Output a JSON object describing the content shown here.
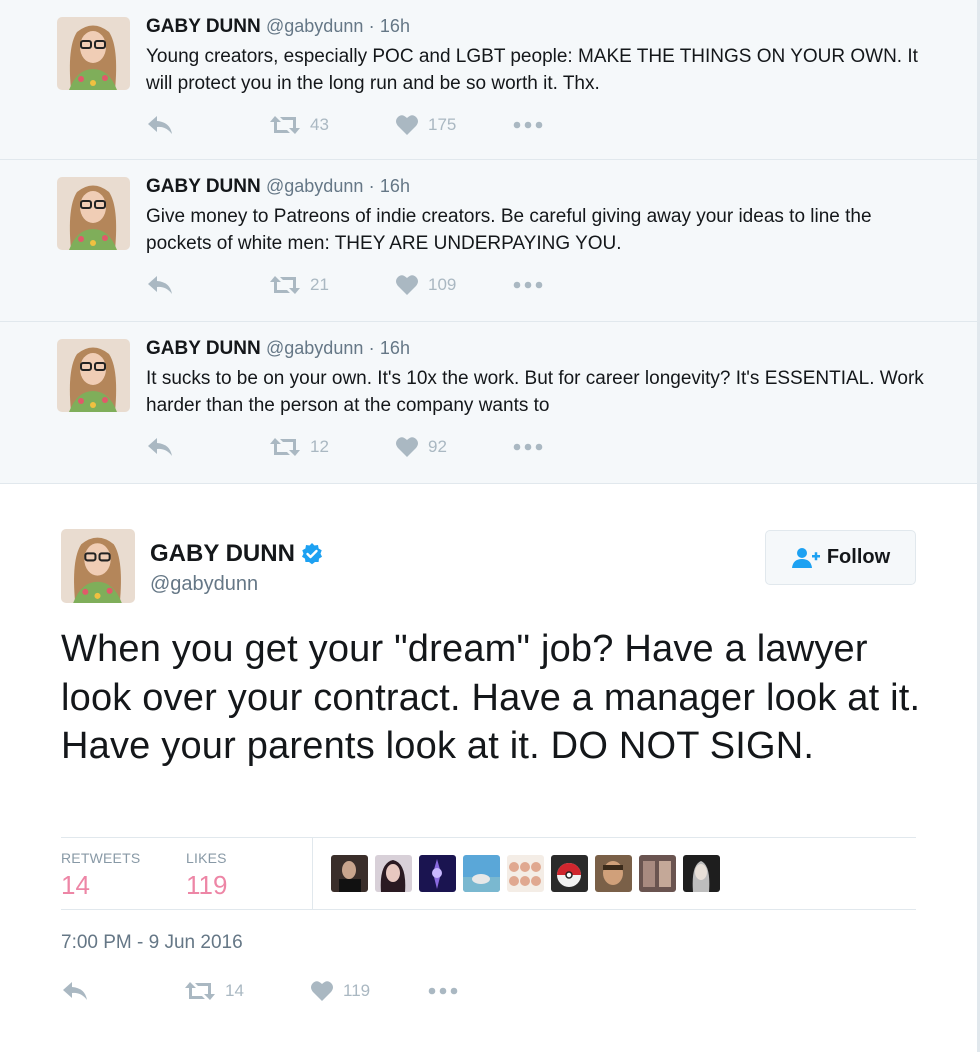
{
  "conversation": [
    {
      "name": "GABY DUNN",
      "handle": "@gabydunn",
      "time": "16h",
      "text": "Young creators, especially POC and LGBT people: MAKE THE THINGS ON YOUR OWN. It will protect you in the long run and be so worth it. Thx.",
      "retweets": "43",
      "likes": "175"
    },
    {
      "name": "GABY DUNN",
      "handle": "@gabydunn",
      "time": "16h",
      "text": "Give money to Patreons of indie creators. Be careful giving away your ideas to line the pockets of white men: THEY ARE UNDERPAYING YOU.",
      "retweets": "21",
      "likes": "109"
    },
    {
      "name": "GABY DUNN",
      "handle": "@gabydunn",
      "time": "16h",
      "text": "It sucks to be on your own. It's 10x the work. But for career longevity? It's ESSENTIAL. Work harder than the person at the company wants to",
      "retweets": "12",
      "likes": "92"
    }
  ],
  "main_tweet": {
    "name": "GABY DUNN",
    "handle": "@gabydunn",
    "follow_label": "Follow",
    "text": "When you get your \"dream\" job? Have a lawyer look over your contract. Have a manager look at it. Have your parents look at it. DO NOT SIGN.",
    "retweets_label": "RETWEETS",
    "retweets": "14",
    "likes_label": "LIKES",
    "likes": "119",
    "timestamp": "7:00 PM - 9 Jun 2016",
    "action_retweets": "14",
    "action_likes": "119"
  },
  "dot_separator": "·",
  "icons": {
    "reply": "reply-icon",
    "retweet": "retweet-icon",
    "like": "heart-icon",
    "more": "more-icon",
    "verified": "verified-badge-icon",
    "follow": "follow-user-icon"
  },
  "colors": {
    "background_conversation": "#f5f8fa",
    "icon_gray": "#aab8c2",
    "verified_blue": "#1da1f2",
    "likes_pink": "#e0245e"
  }
}
